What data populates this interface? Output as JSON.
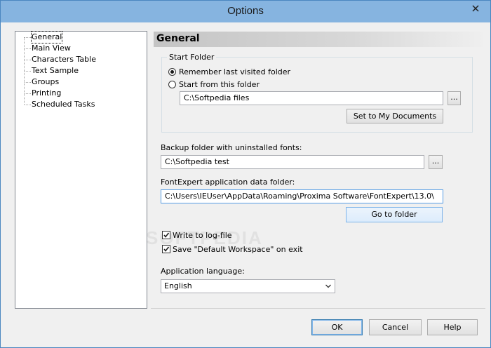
{
  "window": {
    "title": "Options"
  },
  "tree": {
    "items": [
      "General",
      "Main View",
      "Characters Table",
      "Text Sample",
      "Groups",
      "Printing",
      "Scheduled Tasks"
    ],
    "selected": "General"
  },
  "panel": {
    "title": "General"
  },
  "start_folder": {
    "group_label": "Start Folder",
    "remember_label": "Remember last visited folder",
    "start_from_label": "Start from this folder",
    "folder_value": "C:\\Softpedia files",
    "browse_label": "...",
    "set_docs_label": "Set to My Documents"
  },
  "backup": {
    "label": "Backup folder with uninstalled fonts:",
    "value": "C:\\Softpedia test",
    "browse_label": "..."
  },
  "appdata": {
    "label": "FontExpert application data folder:",
    "value": "C:\\Users\\IEUser\\AppData\\Roaming\\Proxima Software\\FontExpert\\13.0\\",
    "goto_label": "Go to folder"
  },
  "options": {
    "log_label": "Write to log-file",
    "workspace_label": "Save \"Default Workspace\" on exit"
  },
  "language": {
    "label": "Application language:",
    "value": "English"
  },
  "buttons": {
    "ok": "OK",
    "cancel": "Cancel",
    "help": "Help"
  },
  "watermark": "SOFTPEDIA",
  "colors": {
    "titlebar": "#86b4e0",
    "accent": "#569de5"
  }
}
